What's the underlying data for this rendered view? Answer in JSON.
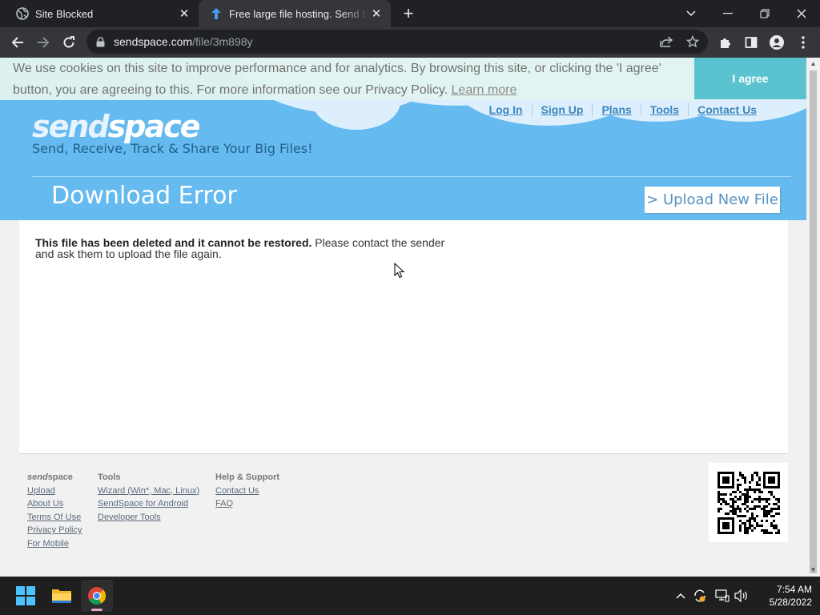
{
  "browser": {
    "tabs": [
      {
        "title": "Site Blocked",
        "icon": "globe-icon"
      },
      {
        "title": "Free large file hosting. Send big files",
        "icon": "sendspace-arrow-icon"
      }
    ],
    "url_host": "sendspace.com",
    "url_path": "/file/3m898y"
  },
  "cookie": {
    "text": "We use cookies on this site to improve performance and for analytics. By browsing this site, or clicking the 'I agree' button, you are agreeing to this. For more information see our Privacy Policy.",
    "learn_more": "Learn more",
    "agree": "I agree"
  },
  "header": {
    "logo_send": "send",
    "logo_space": "space",
    "tagline": "Send, Receive, Track & Share Your Big Files!",
    "nav": [
      "Log In",
      "Sign Up",
      "Plans",
      "Tools",
      "Contact Us"
    ],
    "page_title": "Download Error",
    "upload_button": "> Upload New File"
  },
  "content": {
    "error_bold": "This file has been deleted and it cannot be restored.",
    "error_rest": " Please contact the sender and ask them to upload the file again."
  },
  "footer": {
    "col1": {
      "heading_send": "send",
      "heading_space": "space",
      "links": [
        "Upload",
        "About Us",
        "Terms Of Use",
        "Privacy Policy",
        "For Mobile"
      ]
    },
    "col2": {
      "heading": "Tools",
      "links": [
        "Wizard (Win*, Mac, Linux)",
        "SendSpace for Android",
        "Developer Tools"
      ]
    },
    "col3": {
      "heading": "Help & Support",
      "links": [
        "Contact Us",
        "FAQ"
      ]
    }
  },
  "taskbar": {
    "time": "7:54 AM",
    "date": "5/28/2022",
    "apps": [
      "windows-start-icon",
      "file-explorer-icon",
      "chrome-icon"
    ]
  }
}
